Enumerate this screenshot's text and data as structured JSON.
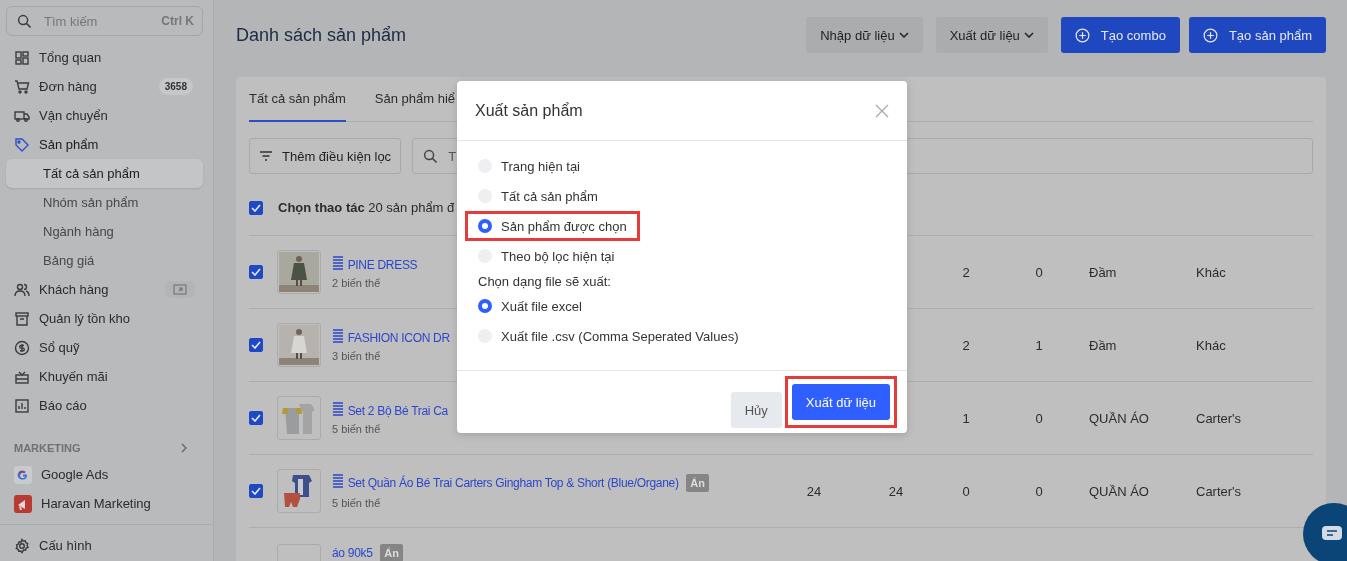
{
  "sidebar": {
    "search": {
      "placeholder": "Tìm kiếm",
      "shortcut": "Ctrl K"
    },
    "items": [
      {
        "label": "Tổng quan",
        "selected": false
      },
      {
        "label": "Đơn hàng",
        "selected": false,
        "badge": "3658"
      },
      {
        "label": "Vận chuyển",
        "selected": false
      },
      {
        "label": "Sản phẩm",
        "selected": true,
        "children": [
          {
            "label": "Tất cả sản phẩm",
            "selected": true
          },
          {
            "label": "Nhóm sản phẩm",
            "selected": false
          },
          {
            "label": "Ngành hàng",
            "selected": false
          },
          {
            "label": "Bảng giá",
            "selected": false
          }
        ]
      },
      {
        "label": "Khách hàng",
        "selected": false,
        "action_icon": true
      },
      {
        "label": "Quản lý tồn kho",
        "selected": false
      },
      {
        "label": "Sổ quỹ",
        "selected": false
      },
      {
        "label": "Khuyến mãi",
        "selected": false
      },
      {
        "label": "Báo cáo",
        "selected": false
      }
    ],
    "section": {
      "title": "MARKETING",
      "items": [
        {
          "label": "Google Ads"
        },
        {
          "label": "Haravan Marketing"
        }
      ]
    },
    "footer_item": {
      "label": "Cấu hình"
    }
  },
  "page": {
    "title": "Danh sách sản phẩm",
    "buttons": [
      {
        "label": "Nhập dữ liệu",
        "kind": "dropdown"
      },
      {
        "label": "Xuất dữ liệu",
        "kind": "dropdown"
      },
      {
        "label": "Tạo combo",
        "kind": "primary"
      },
      {
        "label": "Tạo sản phẩm",
        "kind": "primary"
      }
    ]
  },
  "card": {
    "tabs": [
      {
        "label": "Tất cả sản phẩm",
        "selected": true
      },
      {
        "label": "Sản phẩm hiể",
        "selected": false
      }
    ],
    "filter_button": "Thêm điều kiện lọc",
    "search": {
      "placeholder": "T"
    },
    "bulk": {
      "checked": true,
      "text": "**Chọn thao tác** 20 sản phẩm đ"
    },
    "rows": [
      {
        "checked": true,
        "list_icon": true,
        "name": "PINE DRESS",
        "variants": "2 biến thể",
        "cells": {
          "column_3": "2",
          "column_4": "0",
          "column_5": "Đầm",
          "column_6": "Khác"
        }
      },
      {
        "checked": true,
        "list_icon": true,
        "name": "FASHION ICON DR",
        "variants": "3 biến thể",
        "cells": {
          "column_3": "2",
          "column_4": "1",
          "column_5": "Đầm",
          "column_6": "Khác"
        }
      },
      {
        "checked": true,
        "list_icon": true,
        "name": "Set 2 Bộ Bé Trai Ca",
        "variants": "5 biến thể",
        "cells": {
          "column_3": "1",
          "column_4": "0",
          "column_5": "QUẦN ÁO",
          "column_6": "Carter's"
        }
      },
      {
        "checked": true,
        "list_icon": true,
        "name": "Set Quần Áo Bé Trai Carters Gingham Top & Short (Blue/Organe)",
        "badge": "Ẩn",
        "variants": "5 biến thể",
        "cells": {
          "column_1": "24",
          "column_2": "24",
          "column_3": "0",
          "column_4": "0",
          "column_5": "QUẦN ÁO",
          "column_6": "Carter's"
        }
      },
      {
        "list_icon": false,
        "name": "áo 90k5",
        "badge": "Ẩn"
      }
    ]
  },
  "dialog": {
    "title": "Xuất sản phẩm",
    "scope_options": [
      {
        "label": "Trang hiện tại",
        "selected": false
      },
      {
        "label": "Tất cả sản phẩm",
        "selected": false
      },
      {
        "label": "Sản phẩm được chọn",
        "selected": true,
        "highlighted": true
      },
      {
        "label": "Theo bộ lọc hiện tại",
        "selected": false
      }
    ],
    "format_label": "Chọn dạng file sẽ xuất:",
    "format_options": [
      {
        "label": "Xuất file excel",
        "selected": true
      },
      {
        "label": "Xuất file .csv (Comma Seperated Values)",
        "selected": false
      }
    ],
    "buttons": [
      {
        "label": "Hủy",
        "kind": "secondary"
      },
      {
        "label": "Xuất dữ liệu",
        "kind": "primary",
        "highlighted": true
      }
    ]
  }
}
